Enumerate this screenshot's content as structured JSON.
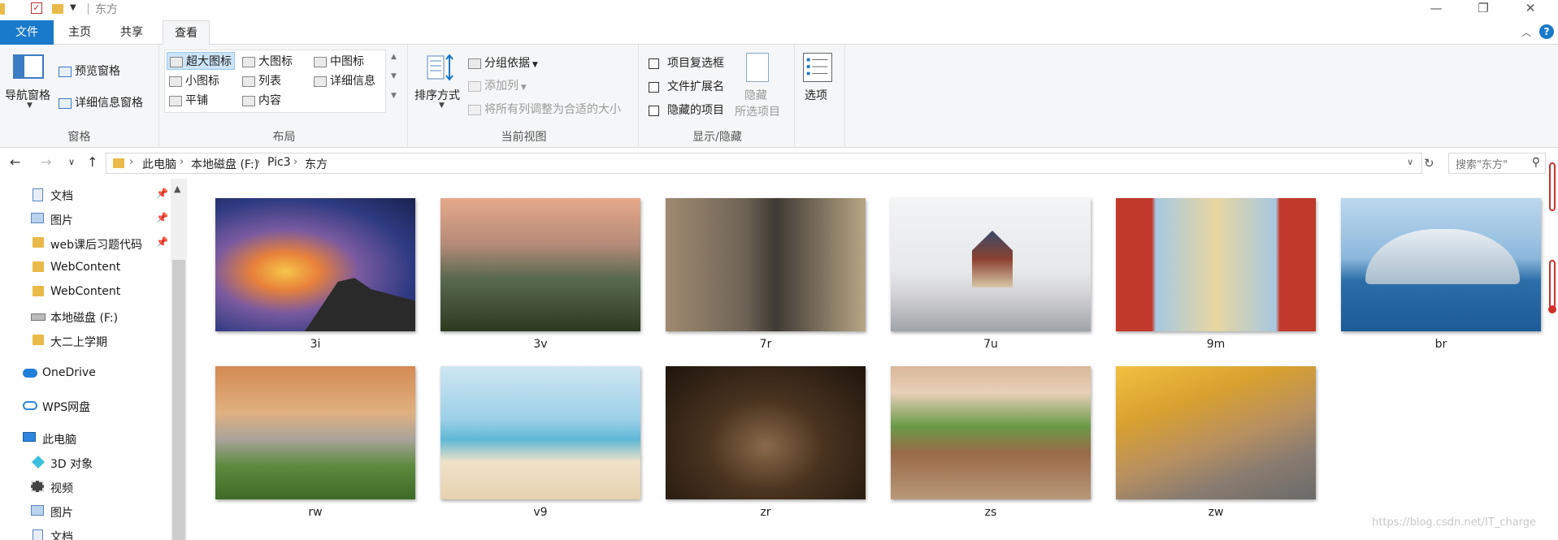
{
  "window": {
    "title": "东方",
    "minimize": "—",
    "restore": "❐",
    "close": "✕"
  },
  "tabs": {
    "file": "文件",
    "home": "主页",
    "share": "共享",
    "view": "查看",
    "active": "查看"
  },
  "ribbon": {
    "panes": {
      "label": "窗格",
      "nav_pane": "导航窗格",
      "preview_pane": "预览窗格",
      "details_pane": "详细信息窗格"
    },
    "layout": {
      "label": "布局",
      "extra_large": "超大图标",
      "large": "大图标",
      "medium": "中图标",
      "small": "小图标",
      "list": "列表",
      "details": "详细信息",
      "tiles": "平铺",
      "content": "内容",
      "selected": "超大图标"
    },
    "current_view": {
      "label": "当前视图",
      "sort_by": "排序方式",
      "group_by": "分组依据",
      "add_column": "添加列",
      "fit_columns": "将所有列调整为合适的大小"
    },
    "show_hide": {
      "label": "显示/隐藏",
      "item_checkbox": "项目复选框",
      "file_extensions": "文件扩展名",
      "hidden_items": "隐藏的项目",
      "hide_selected_line1": "隐藏",
      "hide_selected_line2": "所选项目",
      "item_checkbox_checked": false,
      "file_extensions_checked": false,
      "hidden_items_checked": false
    },
    "options": {
      "label": "选项"
    }
  },
  "address": {
    "crumbs": [
      "此电脑",
      "本地磁盘 (F:)",
      "Pic3",
      "东方"
    ],
    "search_placeholder": "搜索\"东方\""
  },
  "sidebar": {
    "items": [
      {
        "label": "文档",
        "icon": "document-icon",
        "pinned": true
      },
      {
        "label": "图片",
        "icon": "pictures-icon",
        "pinned": true
      },
      {
        "label": "web课后习题代码",
        "icon": "folder-icon",
        "pinned": true
      },
      {
        "label": "WebContent",
        "icon": "folder-icon",
        "pinned": false
      },
      {
        "label": "WebContent",
        "icon": "folder-icon",
        "pinned": false
      },
      {
        "label": "本地磁盘 (F:)",
        "icon": "drive-icon",
        "pinned": false
      },
      {
        "label": "大二上学期",
        "icon": "folder-icon",
        "pinned": false
      },
      {
        "label": "OneDrive",
        "icon": "onedrive-icon",
        "pinned": false
      },
      {
        "label": "WPS网盘",
        "icon": "wps-cloud-icon",
        "pinned": false
      },
      {
        "label": "此电脑",
        "icon": "pc-icon",
        "pinned": false
      },
      {
        "label": "3D 对象",
        "icon": "3d-objects-icon",
        "pinned": false
      },
      {
        "label": "视频",
        "icon": "video-icon",
        "pinned": false
      },
      {
        "label": "图片",
        "icon": "pictures-icon",
        "pinned": false
      },
      {
        "label": "文档",
        "icon": "document-icon",
        "pinned": false
      }
    ]
  },
  "files": [
    {
      "name": "3i"
    },
    {
      "name": "3v"
    },
    {
      "name": "7r"
    },
    {
      "name": "7u"
    },
    {
      "name": "9m"
    },
    {
      "name": "br"
    },
    {
      "name": "rw"
    },
    {
      "name": "v9"
    },
    {
      "name": "zr"
    },
    {
      "name": "zs"
    },
    {
      "name": "zw"
    }
  ],
  "watermark": "https://blog.csdn.net/IT_charge",
  "colors": {
    "accent": "#1979ca",
    "ribbon_bg": "#f5f6f7",
    "selected_bg": "#cce4f7",
    "folder": "#e9b949"
  }
}
